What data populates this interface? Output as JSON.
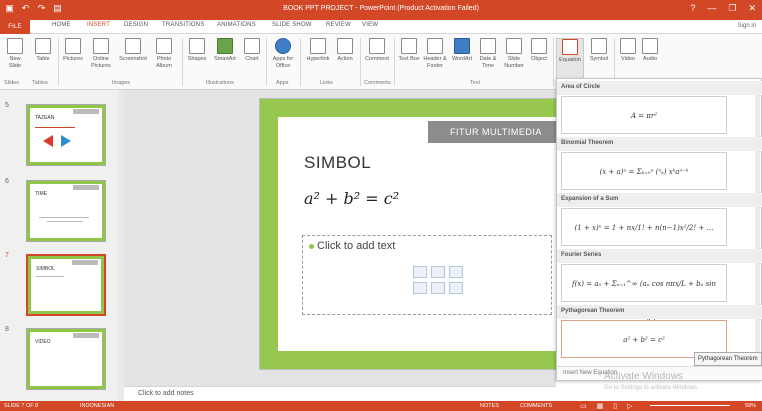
{
  "window": {
    "title": "BOOK PPT PROJECT - PowerPoint (Product Activation Failed)",
    "help": "?",
    "minimize": "—",
    "restore": "❐",
    "close": "✕"
  },
  "qat": {
    "save": "▣",
    "undo": "↶",
    "redo": "↷",
    "start": "▤"
  },
  "tabs": [
    "FILE",
    "HOME",
    "INSERT",
    "DESIGN",
    "TRANSITIONS",
    "ANIMATIONS",
    "SLIDE SHOW",
    "REVIEW",
    "VIEW"
  ],
  "active_tab": "INSERT",
  "signin": "Sign in",
  "ribbon": {
    "buttons": [
      "New Slide",
      "Table",
      "Pictures",
      "Online Pictures",
      "Screenshot",
      "Photo Album",
      "Shapes",
      "SmartArt",
      "Chart",
      "Apps for Office",
      "Hyperlink",
      "Action",
      "Comment",
      "Text Box",
      "Header & Footer",
      "WordArt",
      "Date & Time",
      "Slide Number",
      "Object",
      "Equation",
      "Symbol",
      "Video",
      "Audio"
    ],
    "groups": [
      "Slides",
      "Tables",
      "Images",
      "Illustrations",
      "Apps",
      "Links",
      "Comments",
      "Text"
    ]
  },
  "slides_panel": {
    "numbers": [
      "5",
      "6",
      "7",
      "8"
    ],
    "thumb_titles": [
      "TAZEAN",
      "TIME",
      "SIMBOL",
      "VIDEO"
    ]
  },
  "slide": {
    "banner": "FITUR MULTIMEDIA",
    "title": "SIMBOL",
    "equation": "a² + b² = c²",
    "placeholder": "Click to add text"
  },
  "notes": "Click to add notes",
  "equations": [
    {
      "name": "Area of Circle",
      "formula": "A = πr²"
    },
    {
      "name": "Binomial Theorem",
      "formula": "(x + a)ⁿ = Σₖ₌₀ⁿ (ⁿₖ) xᵏaⁿ⁻ᵏ"
    },
    {
      "name": "Expansion of a Sum",
      "formula": "(1 + x)ⁿ = 1 + nx/1! + n(n−1)x²/2! + …"
    },
    {
      "name": "Fourier Series",
      "formula": "f(x) = a₀ + Σₙ₌₁^∞ (aₙ cos nπx/L + bₙ sin nπx/L)"
    },
    {
      "name": "Pythagorean Theorem",
      "formula": "a² + b² = c²"
    }
  ],
  "eq_footer": "Insert New Equation",
  "tooltip": "Pythagorean Theorem",
  "watermark": {
    "line1": "Activate Windows",
    "line2": "Go to Settings to activate Windows."
  },
  "status": {
    "slide": "SLIDE 7 OF 8",
    "language": "INDONESIAN",
    "notes": "NOTES",
    "comments": "COMMENTS",
    "zoom": "59%"
  },
  "colors": {
    "accent": "#d24726",
    "slide_green": "#97c74f"
  }
}
